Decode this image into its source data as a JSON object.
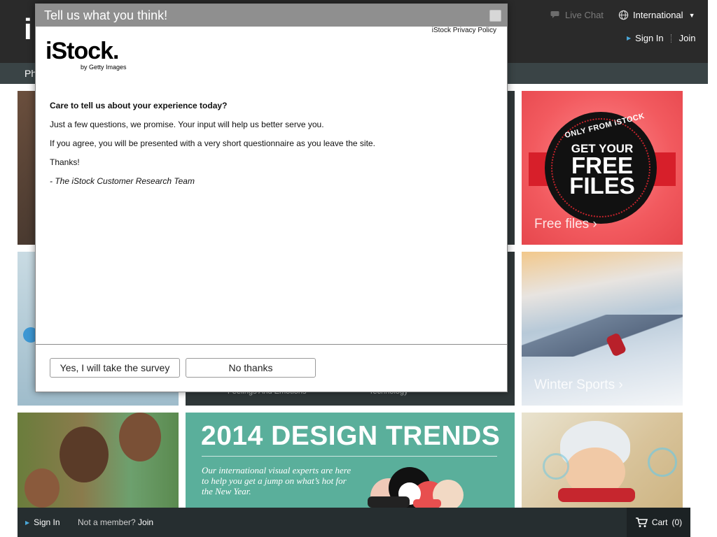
{
  "header": {
    "logo": "iStock",
    "live_chat": "Live Chat",
    "international": "International",
    "sign_in": "Sign In",
    "join": "Join",
    "nav_first_item": "Ph"
  },
  "tiles": {
    "free_files": {
      "badge_top": "ONLY FROM iSTOCK",
      "badge_line1": "GET YOUR",
      "badge_line2": "FREE",
      "badge_line3": "FILES",
      "label": "Free files ›"
    },
    "winter_sports": {
      "label": "Winter Sports ›"
    },
    "feelings_sub": "Feelings And Emotions",
    "technology_sub": "Technology",
    "design_trends": {
      "title": "2014 DESIGN TRENDS",
      "description": "Our international visual experts are here to help you get a jump on what’s hot for the New Year."
    }
  },
  "bottom_bar": {
    "sign_in": "Sign In",
    "not_member": "Not a member?",
    "join": "Join",
    "cart_label": "Cart",
    "cart_count": "(0)"
  },
  "modal": {
    "title": "Tell us what you think!",
    "privacy_link": "iStock Privacy Policy",
    "brand_name": "iStock.",
    "brand_sub": "by Getty Images",
    "question": "Care to tell us about your experience today?",
    "line1": "Just a few questions, we promise. Your input will help us better serve you.",
    "line2": "If you agree, you will be presented with a very short questionnaire as you leave the site.",
    "thanks": "Thanks!",
    "signature": "- The iStock Customer Research Team",
    "yes_button": "Yes, I will take the survey",
    "no_button": "No thanks"
  },
  "colors": {
    "header_bg": "#2a2a2a",
    "nav_bg": "#3a4446",
    "modal_header": "#8f8f8f",
    "trends_bg": "#5aaf9b",
    "free_bg": "#f25a5f",
    "accent_blue": "#4aa7d8"
  }
}
